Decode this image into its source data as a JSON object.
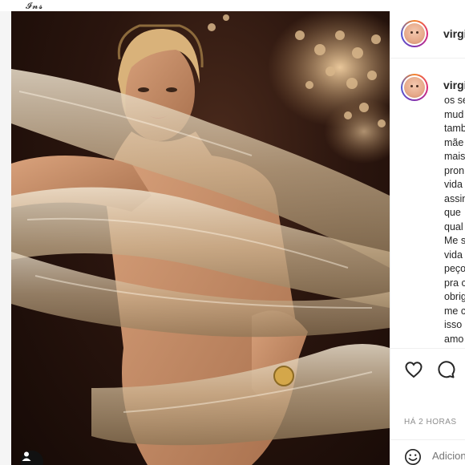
{
  "brand_fragment": "Instagram",
  "post": {
    "username": "virginia",
    "caption_lines": [
      "os se",
      "mud",
      "tamb",
      "mãe",
      "mais",
      "pron",
      "vida",
      "assin",
      "que",
      "qual",
      "Me s",
      "vida",
      "peço",
      "pra c",
      "obrig",
      "me c",
      "isso",
      "amo"
    ],
    "timestamp": "HÁ 2 HORAS",
    "comment_placeholder": "Adicione um comentário..."
  },
  "colors": {
    "accent_ring": [
      "#f58529",
      "#dd2a7b",
      "#8134af",
      "#515bd4"
    ],
    "text_primary": "#262626",
    "text_secondary": "#8e8e8e",
    "divider": "#efefef"
  },
  "icons": {
    "like": "heart-icon",
    "comment": "comment-icon",
    "emoji": "emoji-icon",
    "media_overlay": "user-silhouette-icon"
  }
}
